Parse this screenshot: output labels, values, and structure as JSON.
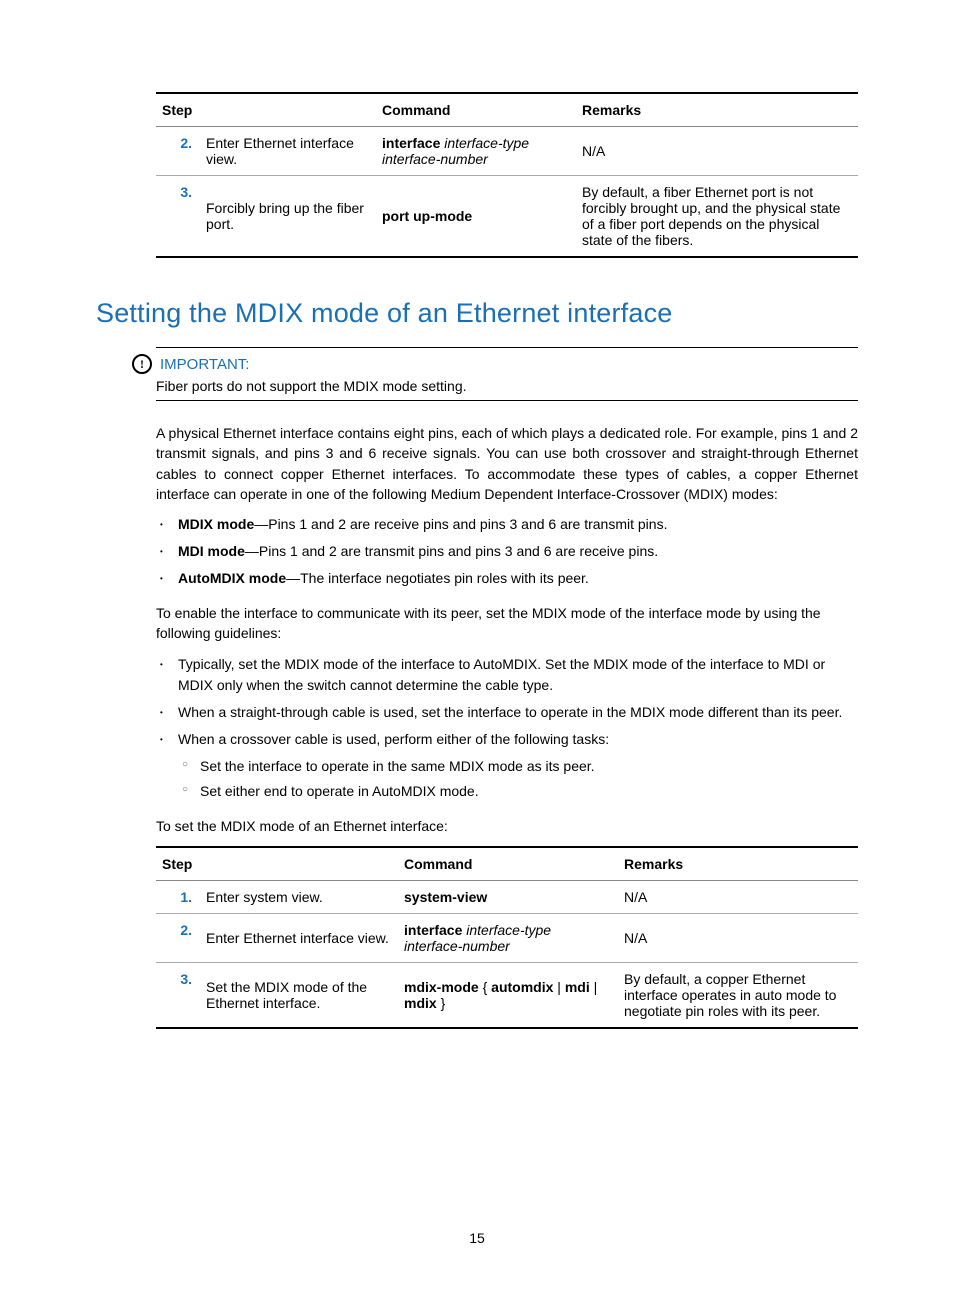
{
  "page_number": "15",
  "table1": {
    "headers": {
      "step": "Step",
      "command": "Command",
      "remarks": "Remarks"
    },
    "rows": [
      {
        "num": "2.",
        "step": "Enter Ethernet interface view.",
        "cmd_bold": "interface",
        "cmd_italic_a": " interface-type",
        "cmd_italic_b": "interface-number",
        "remarks": "N/A"
      },
      {
        "num": "3.",
        "step": "Forcibly bring up the fiber port.",
        "cmd_bold": "port up-mode",
        "remarks": "By default, a fiber Ethernet port is not forcibly brought up, and the physical state of a fiber port depends on the physical state of the fibers."
      }
    ]
  },
  "heading": "Setting the MDIX mode of an Ethernet interface",
  "important": {
    "label": "IMPORTANT:",
    "text": "Fiber ports do not support the MDIX mode setting."
  },
  "para1": "A physical Ethernet interface contains eight pins, each of which plays a dedicated role. For example, pins 1 and 2 transmit signals, and pins 3 and 6 receive signals. You can use both crossover and straight-through Ethernet cables to connect copper Ethernet interfaces. To accommodate these types of cables, a copper Ethernet interface can operate in one of the following Medium Dependent Interface-Crossover (MDIX) modes:",
  "modes": [
    {
      "b": "MDIX mode",
      "t": "—Pins 1 and 2 are receive pins and pins 3 and 6 are transmit pins."
    },
    {
      "b": "MDI mode",
      "t": "—Pins 1 and 2 are transmit pins and pins 3 and 6 are receive pins."
    },
    {
      "b": "AutoMDIX mode",
      "t": "—The interface negotiates pin roles with its peer."
    }
  ],
  "para2": "To enable the interface to communicate with its peer, set the MDIX mode of the interface mode by using the following guidelines:",
  "guidelines": [
    {
      "t": "Typically, set the MDIX mode of the interface to AutoMDIX. Set the MDIX mode of the interface to MDI or MDIX only when the switch cannot determine the cable type."
    },
    {
      "t": "When a straight-through cable is used, set the interface to operate in the MDIX mode different than its peer."
    },
    {
      "t": "When a crossover cable is used, perform either of the following tasks:",
      "sub": [
        "Set the interface to operate in the same MDIX mode as its peer.",
        "Set either end to operate in AutoMDIX mode."
      ]
    }
  ],
  "para3": "To set the MDIX mode of an Ethernet interface:",
  "table2": {
    "headers": {
      "step": "Step",
      "command": "Command",
      "remarks": "Remarks"
    },
    "rows": [
      {
        "num": "1.",
        "step": "Enter system view.",
        "cmd_bold": "system-view",
        "remarks": "N/A"
      },
      {
        "num": "2.",
        "step": "Enter Ethernet interface view.",
        "cmd_bold": "interface",
        "cmd_italic_a": " interface-type",
        "cmd_italic_b": "interface-number",
        "remarks": "N/A"
      },
      {
        "num": "3.",
        "step": "Set the MDIX mode of the Ethernet interface.",
        "cmd_b1": "mdix-mode",
        "cmd_p1": " { ",
        "cmd_b2": "automdix",
        "cmd_p2": " | ",
        "cmd_b3": "mdi",
        "cmd_p3": " | ",
        "cmd_b4": "mdix",
        "cmd_p4": " }",
        "remarks": "By default, a copper Ethernet interface operates in auto mode to negotiate pin roles with its peer."
      }
    ]
  }
}
